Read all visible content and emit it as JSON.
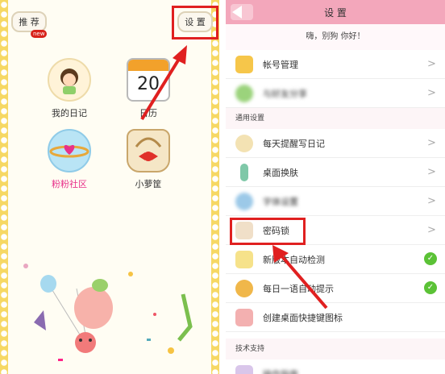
{
  "left": {
    "recommend_label": "推 荐",
    "new_badge": "new",
    "settings_label": "设 置",
    "apps": [
      {
        "label": "我的日记",
        "icon": "diary-doll-icon"
      },
      {
        "label": "日历",
        "icon": "calendar-icon",
        "day": "20"
      },
      {
        "label": "粉粉社区",
        "icon": "globe-heart-icon"
      },
      {
        "label": "小萝筐",
        "icon": "basket-icon"
      }
    ]
  },
  "right": {
    "title": "设 置",
    "greeting": "嗨，别狗 你好！",
    "account_rows": [
      {
        "label": "帐号管理"
      },
      {
        "label": "与好友分享"
      }
    ],
    "general_header": "通用设置",
    "general_rows": [
      {
        "label": "每天提醒写日记"
      },
      {
        "label": "桌面换肤"
      },
      {
        "label": "字体设置"
      },
      {
        "label": "密码锁"
      },
      {
        "label": "新版本自动检测",
        "toggle": "✓"
      },
      {
        "label": "每日一语自动提示",
        "toggle": "✓"
      },
      {
        "label": "创建桌面快捷键图标"
      }
    ],
    "support_header": "技术支持",
    "support_rows": [
      {
        "label": "操作指南"
      }
    ]
  },
  "colors": {
    "accent_pink": "#f3a7bb",
    "highlight_red": "#e02020",
    "toggle_green": "#5bc236",
    "stamp_yellow": "#f6d864"
  }
}
